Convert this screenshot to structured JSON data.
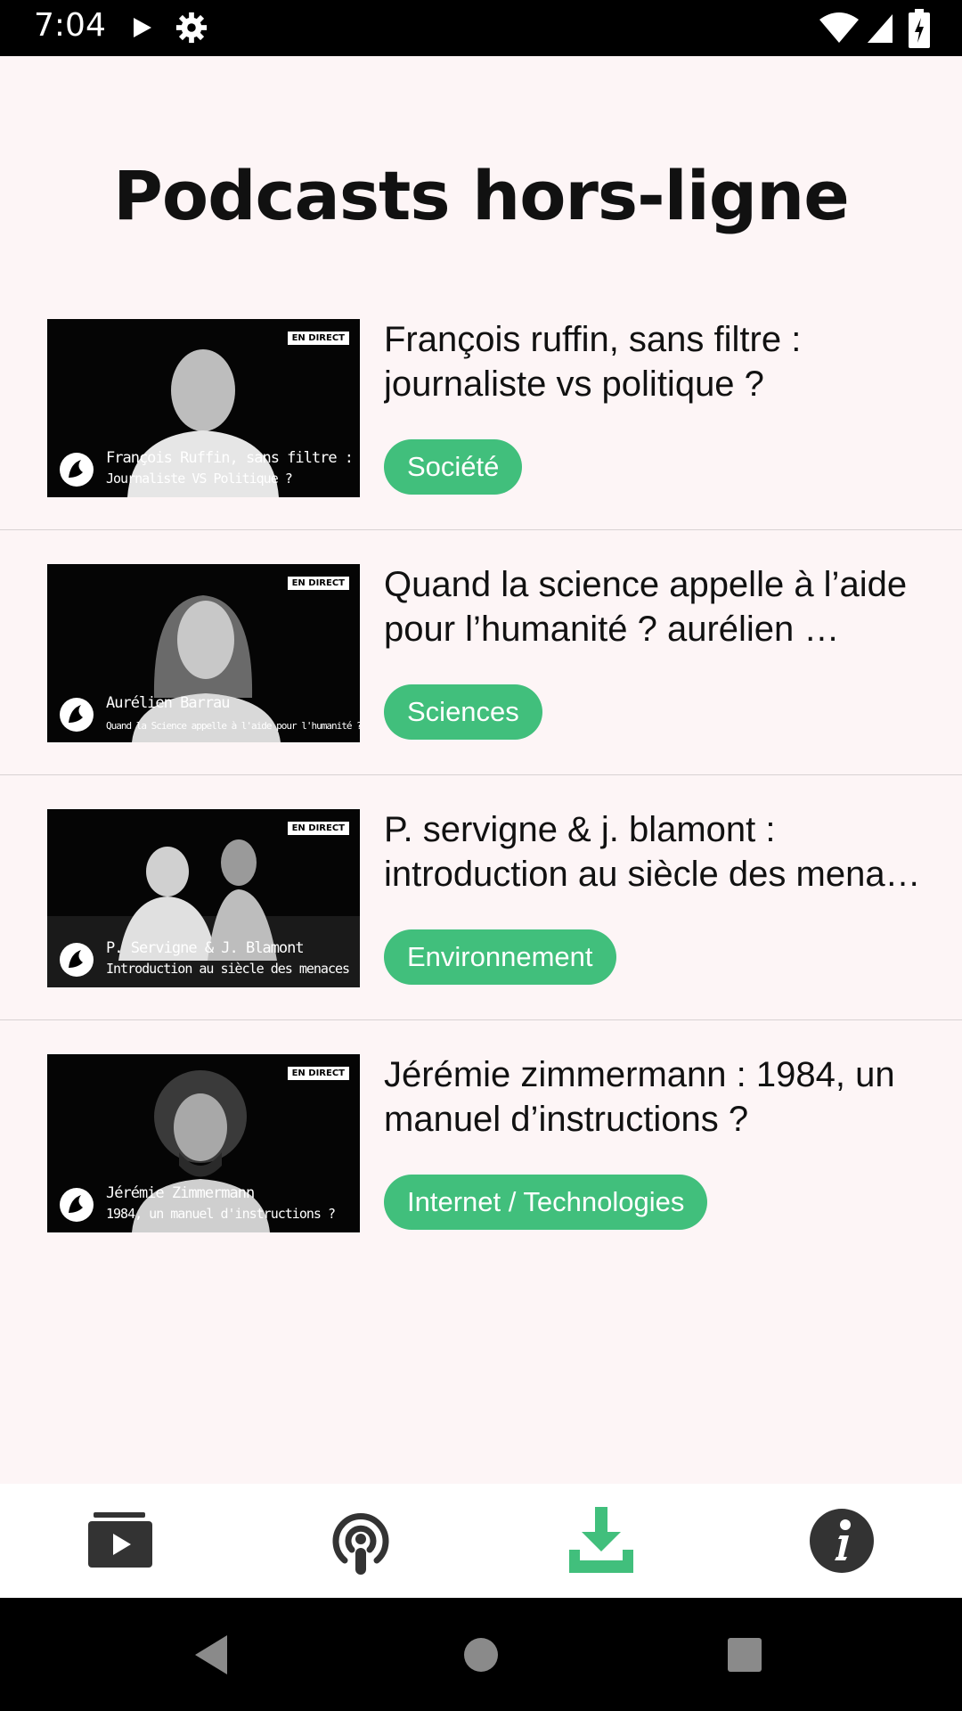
{
  "status_bar": {
    "time": "7:04",
    "icons": [
      "play-icon",
      "gear-icon",
      "wifi-icon",
      "signal-icon",
      "battery-icon"
    ]
  },
  "page": {
    "title": "Podcasts hors-ligne"
  },
  "podcasts": [
    {
      "title": "François ruffin, sans filtre : journaliste vs politique ?",
      "tag": "Société",
      "thumb_badge": "EN DIRECT",
      "thumb_caption_1": "François Ruffin, sans filtre :",
      "thumb_caption_2": "Journaliste VS Politique ?"
    },
    {
      "title": "Quand la science appelle à l’aide pour l’humanité ? aurélien …",
      "tag": "Sciences",
      "thumb_badge": "EN DIRECT",
      "thumb_caption_1": "Aurélien Barrau",
      "thumb_caption_2": "Quand la Science appelle à l'aide pour l'humanité ?"
    },
    {
      "title": "P. servigne & j. blamont : introduction au siècle des mena…",
      "tag": "Environnement",
      "thumb_badge": "EN DIRECT",
      "thumb_caption_1": "P. Servigne & J. Blamont",
      "thumb_caption_2": "Introduction au siècle des menaces"
    },
    {
      "title": "Jérémie zimmermann : 1984, un manuel d’instructions ?",
      "tag": "Internet / Technologies",
      "thumb_badge": "EN DIRECT",
      "thumb_caption_1": "Jérémie Zimmermann",
      "thumb_caption_2": "1984, un manuel d'instructions ?"
    }
  ],
  "bottom_nav": {
    "items": [
      {
        "icon": "video-folder-icon",
        "active": false
      },
      {
        "icon": "podcast-icon",
        "active": false
      },
      {
        "icon": "download-icon",
        "active": true
      },
      {
        "icon": "info-icon",
        "active": false
      }
    ],
    "active_color": "#41bf7c",
    "inactive_color": "#333333"
  },
  "colors": {
    "accent": "#41bf7c",
    "background": "#fdf5f6"
  }
}
